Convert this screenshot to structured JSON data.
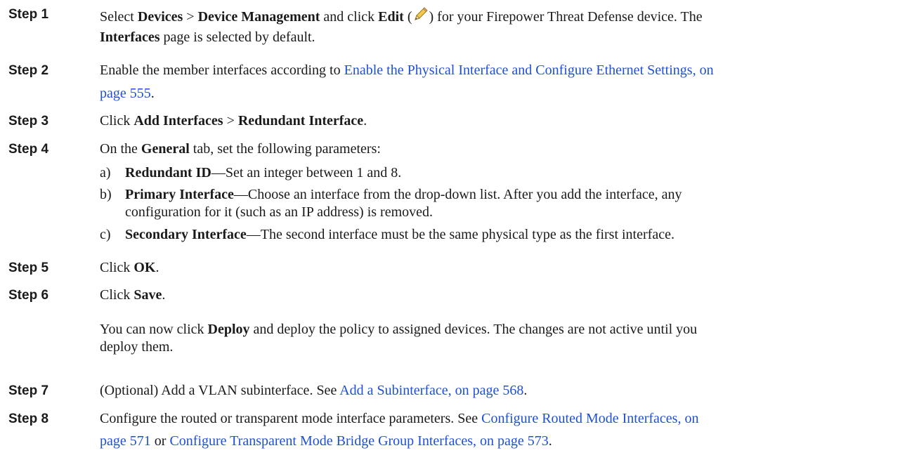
{
  "steps": [
    {
      "label": "Step 1"
    },
    {
      "label": "Step 2"
    },
    {
      "label": "Step 3"
    },
    {
      "label": "Step 4"
    },
    {
      "label": "Step 5"
    },
    {
      "label": "Step 6"
    },
    {
      "label": "Step 7"
    },
    {
      "label": "Step 8"
    }
  ],
  "s1": {
    "t1": "Select ",
    "b1": "Devices",
    "t2": " > ",
    "b2": "Device Management",
    "t3": " and click ",
    "b3": "Edit",
    "t4": " (",
    "t5": ") for your Firepower Threat Defense device. The",
    "b4": "Interfaces",
    "t6": " page is selected by default."
  },
  "s2": {
    "t1": "Enable the member interfaces according to ",
    "link1": "Enable the Physical Interface and Configure Ethernet Settings, on",
    "link2": "page 555",
    "t2": "."
  },
  "s3": {
    "t1": "Click ",
    "b1": "Add Interfaces",
    "t2": " > ",
    "b2": "Redundant Interface",
    "t3": "."
  },
  "s4": {
    "t1": "On the ",
    "b1": "General",
    "t2": " tab, set the following parameters:",
    "items": [
      {
        "marker": "a)",
        "bold": "Redundant ID",
        "text": "—Set an integer between 1 and 8."
      },
      {
        "marker": "b)",
        "bold": "Primary Interface",
        "text": "—Choose an interface from the drop-down list. After you add the interface, any",
        "cont": "configuration for it (such as an IP address) is removed."
      },
      {
        "marker": "c)",
        "bold": "Secondary Interface",
        "text": "—The second interface must be the same physical type as the first interface."
      }
    ]
  },
  "s5": {
    "t1": "Click ",
    "b1": "OK",
    "t2": "."
  },
  "s6": {
    "t1": "Click ",
    "b1": "Save",
    "t2": ".",
    "p1": "You can now click ",
    "pb": "Deploy",
    "p2": " and deploy the policy to assigned devices. The changes are not active until you",
    "p3": "deploy them."
  },
  "s7": {
    "t1": "(Optional) Add a VLAN subinterface. See ",
    "link1": "Add a Subinterface, on page 568",
    "t2": "."
  },
  "s8": {
    "t1": "Configure the routed or transparent mode interface parameters. See ",
    "link1": "Configure Routed Mode Interfaces, on",
    "link2": "page 571",
    "t2": " or ",
    "link3": "Configure Transparent Mode Bridge Group Interfaces, on page 573",
    "t3": "."
  },
  "icons": {
    "edit": "pencil-icon"
  }
}
